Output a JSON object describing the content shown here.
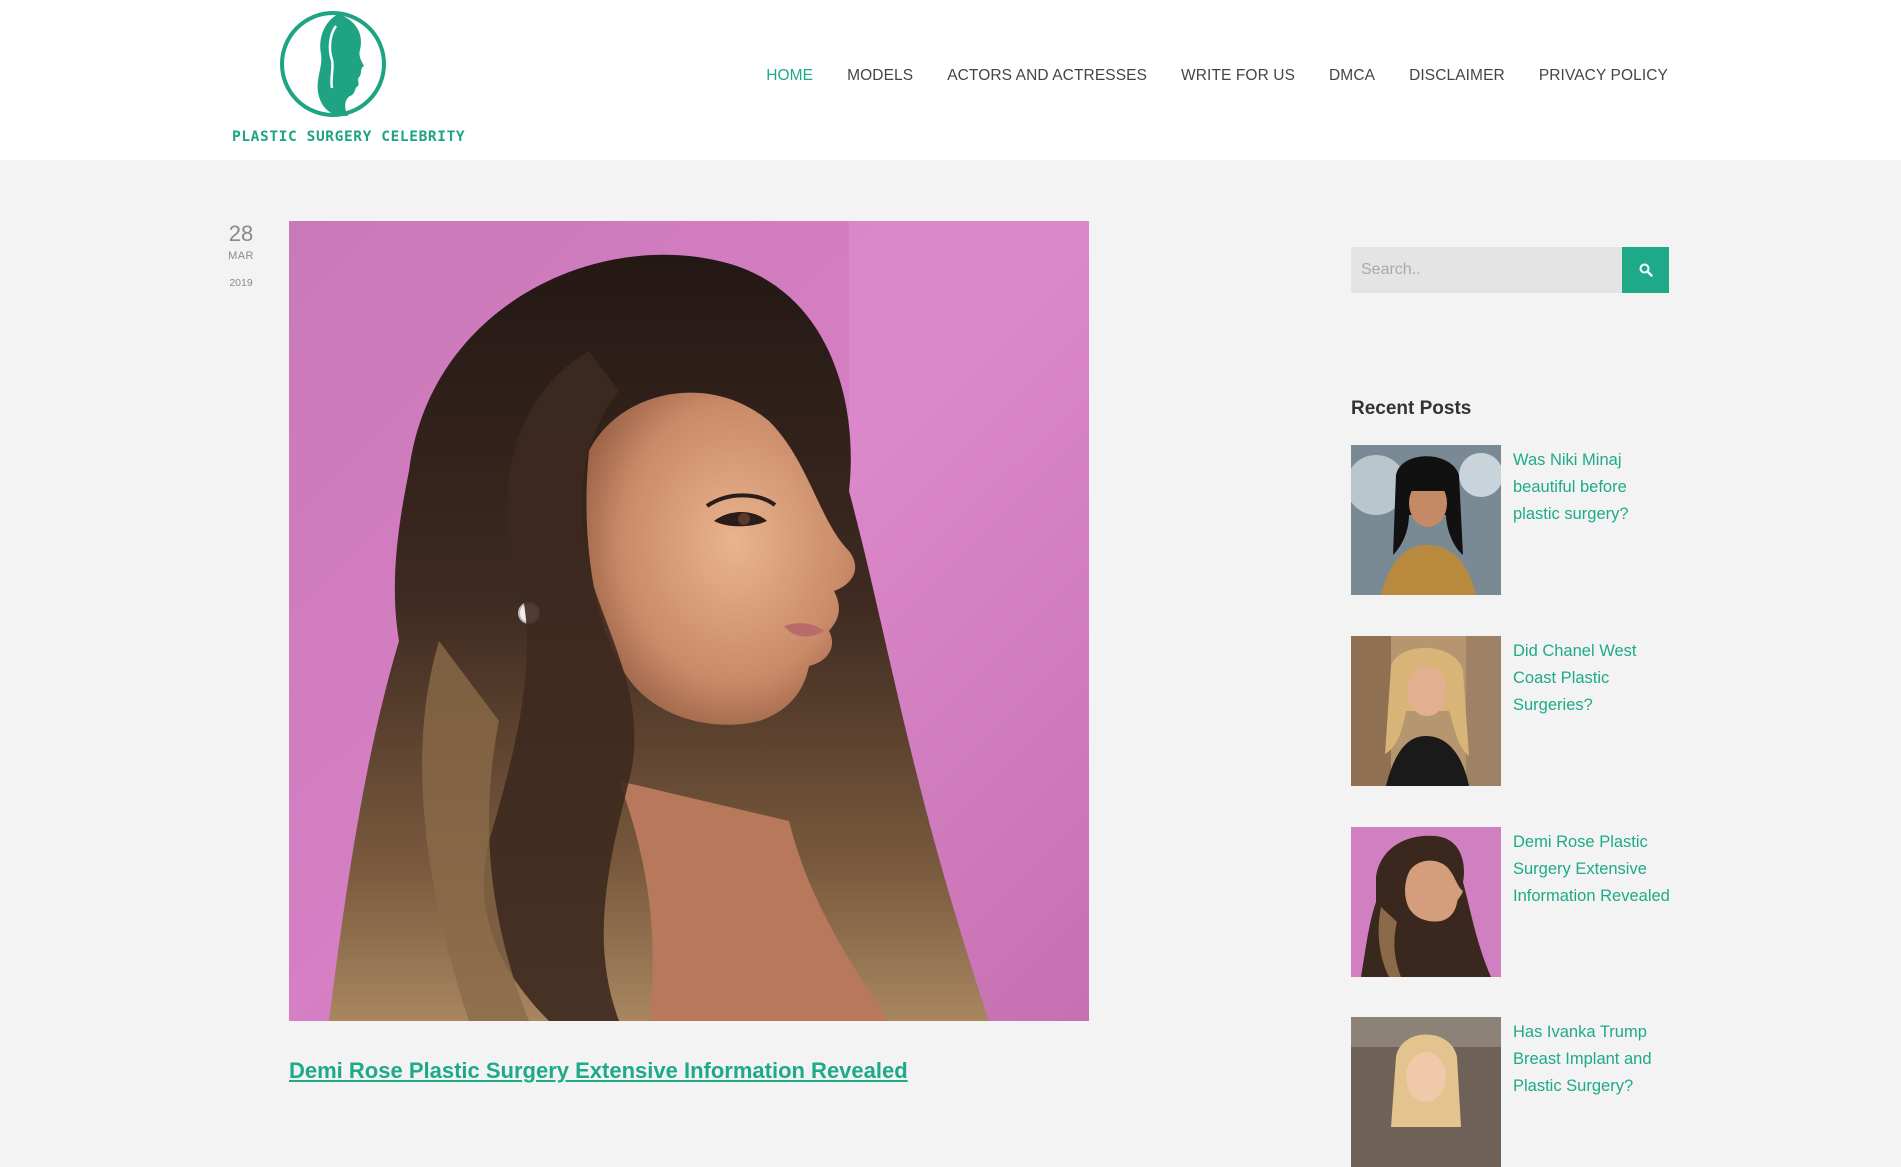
{
  "site": {
    "logo_text": "PLASTIC SURGERY CELEBRITY",
    "accent_color": "#1eaa88"
  },
  "nav": {
    "items": [
      {
        "label": "HOME",
        "active": true
      },
      {
        "label": "MODELS",
        "active": false
      },
      {
        "label": "ACTORS AND ACTRESSES",
        "active": false
      },
      {
        "label": "WRITE FOR US",
        "active": false
      },
      {
        "label": "DMCA",
        "active": false
      },
      {
        "label": "DISCLAIMER",
        "active": false
      },
      {
        "label": "PRIVACY POLICY",
        "active": false
      }
    ]
  },
  "post": {
    "date_day": "28",
    "date_month": "MAR",
    "date_year": "2019",
    "title": "Demi Rose Plastic Surgery Extensive Information Revealed"
  },
  "sidebar": {
    "search": {
      "placeholder": "Search..",
      "button_icon": "search-icon"
    },
    "recent_heading": "Recent Posts",
    "recent_posts": [
      {
        "title": "Was Niki Minaj beautiful before plastic surgery?"
      },
      {
        "title": "Did Chanel West Coast Plastic Surgeries?"
      },
      {
        "title": "Demi Rose Plastic Surgery Extensive Information Revealed"
      },
      {
        "title": "Has Ivanka Trump Breast Implant and Plastic Surgery?"
      }
    ]
  }
}
